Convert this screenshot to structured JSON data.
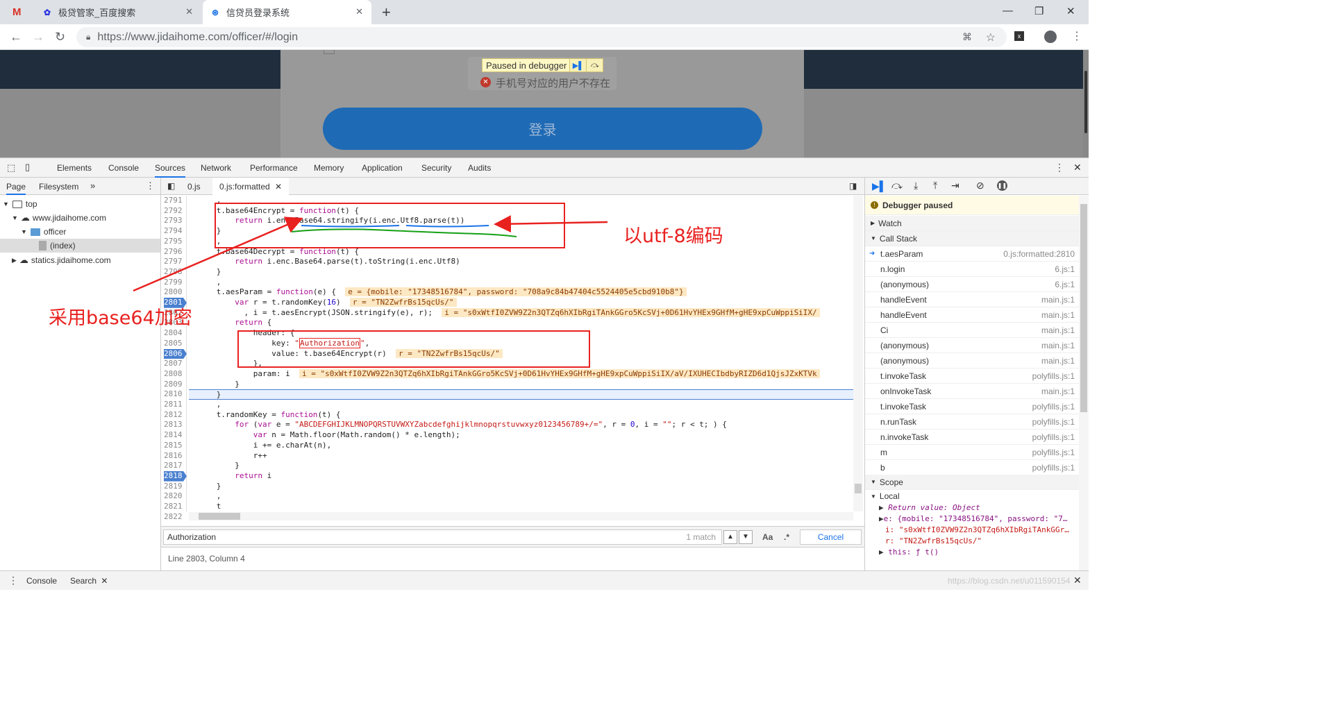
{
  "browser": {
    "tabs": [
      {
        "title": "极贷管家_百度搜索"
      },
      {
        "title": "信贷员登录系统"
      }
    ],
    "url": "https://www.jidaihome.com/officer/#/login",
    "new_tab_label": "+"
  },
  "page": {
    "toast_message": "手机号对应的用户不存在",
    "paused_label": "Paused in debugger",
    "login_button": "登录"
  },
  "devtools": {
    "tabs": [
      "Elements",
      "Console",
      "Sources",
      "Network",
      "Performance",
      "Memory",
      "Application",
      "Security",
      "Audits"
    ],
    "active_tab": "Sources",
    "navigator_tabs": [
      "Page",
      "Filesystem"
    ],
    "tree": {
      "top": "top",
      "domain1": "www.jidaihome.com",
      "folder": "officer",
      "file": "(index)",
      "domain2": "statics.jidaihome.com"
    },
    "editor_tabs": [
      "0.js",
      "0.js:formatted"
    ],
    "line_numbers": [
      "2791",
      "2792",
      "2793",
      "2794",
      "2795",
      "2796",
      "2797",
      "2798",
      "2799",
      "2800",
      "2801",
      "2802",
      "2803",
      "2804",
      "2805",
      "2806",
      "2807",
      "2808",
      "2809",
      "2810",
      "2811",
      "2812",
      "2813",
      "2814",
      "2815",
      "2816",
      "2817",
      "2818",
      "2819",
      "2820",
      "2821",
      "2822"
    ],
    "breakpoint_lines": [
      "2801",
      "2806",
      "2818"
    ],
    "search_value": "Authorization",
    "search_count": "1 match",
    "search_case": "Aa",
    "search_regex": ".*",
    "search_cancel": "Cancel",
    "status": "Line 2803, Column 4",
    "debugger_paused": "Debugger paused",
    "watch_label": "Watch",
    "callstack_label": "Call Stack",
    "call_stack": [
      {
        "name": "t.aesParam",
        "loc": "0.js:formatted:2810"
      },
      {
        "name": "n.login",
        "loc": "6.js:1"
      },
      {
        "name": "(anonymous)",
        "loc": "6.js:1"
      },
      {
        "name": "handleEvent",
        "loc": "main.js:1"
      },
      {
        "name": "handleEvent",
        "loc": "main.js:1"
      },
      {
        "name": "Ci",
        "loc": "main.js:1"
      },
      {
        "name": "(anonymous)",
        "loc": "main.js:1"
      },
      {
        "name": "(anonymous)",
        "loc": "main.js:1"
      },
      {
        "name": "t.invokeTask",
        "loc": "polyfills.js:1"
      },
      {
        "name": "onInvokeTask",
        "loc": "main.js:1"
      },
      {
        "name": "t.invokeTask",
        "loc": "polyfills.js:1"
      },
      {
        "name": "n.runTask",
        "loc": "polyfills.js:1"
      },
      {
        "name": "n.invokeTask",
        "loc": "polyfills.js:1"
      },
      {
        "name": "m",
        "loc": "polyfills.js:1"
      },
      {
        "name": "b",
        "loc": "polyfills.js:1"
      }
    ],
    "scope_label": "Scope",
    "local_label": "Local",
    "scope_entries": [
      "Return value: Object",
      "e: {mobile: \"17348516784\", password: \"7…",
      "i: \"s0xWtfI0ZVW9Z2n3QTZq6hXIbRgiTAnkGGr…",
      "r: \"TN2ZwfrBs15qcUs/\"",
      "this: ƒ t()"
    ],
    "drawer_tabs": [
      "Console",
      "Search"
    ]
  },
  "annotations": {
    "utf8": "以utf-8编码",
    "base64": "采用base64加密"
  },
  "watermark": "https://blog.csdn.net/u011590154"
}
